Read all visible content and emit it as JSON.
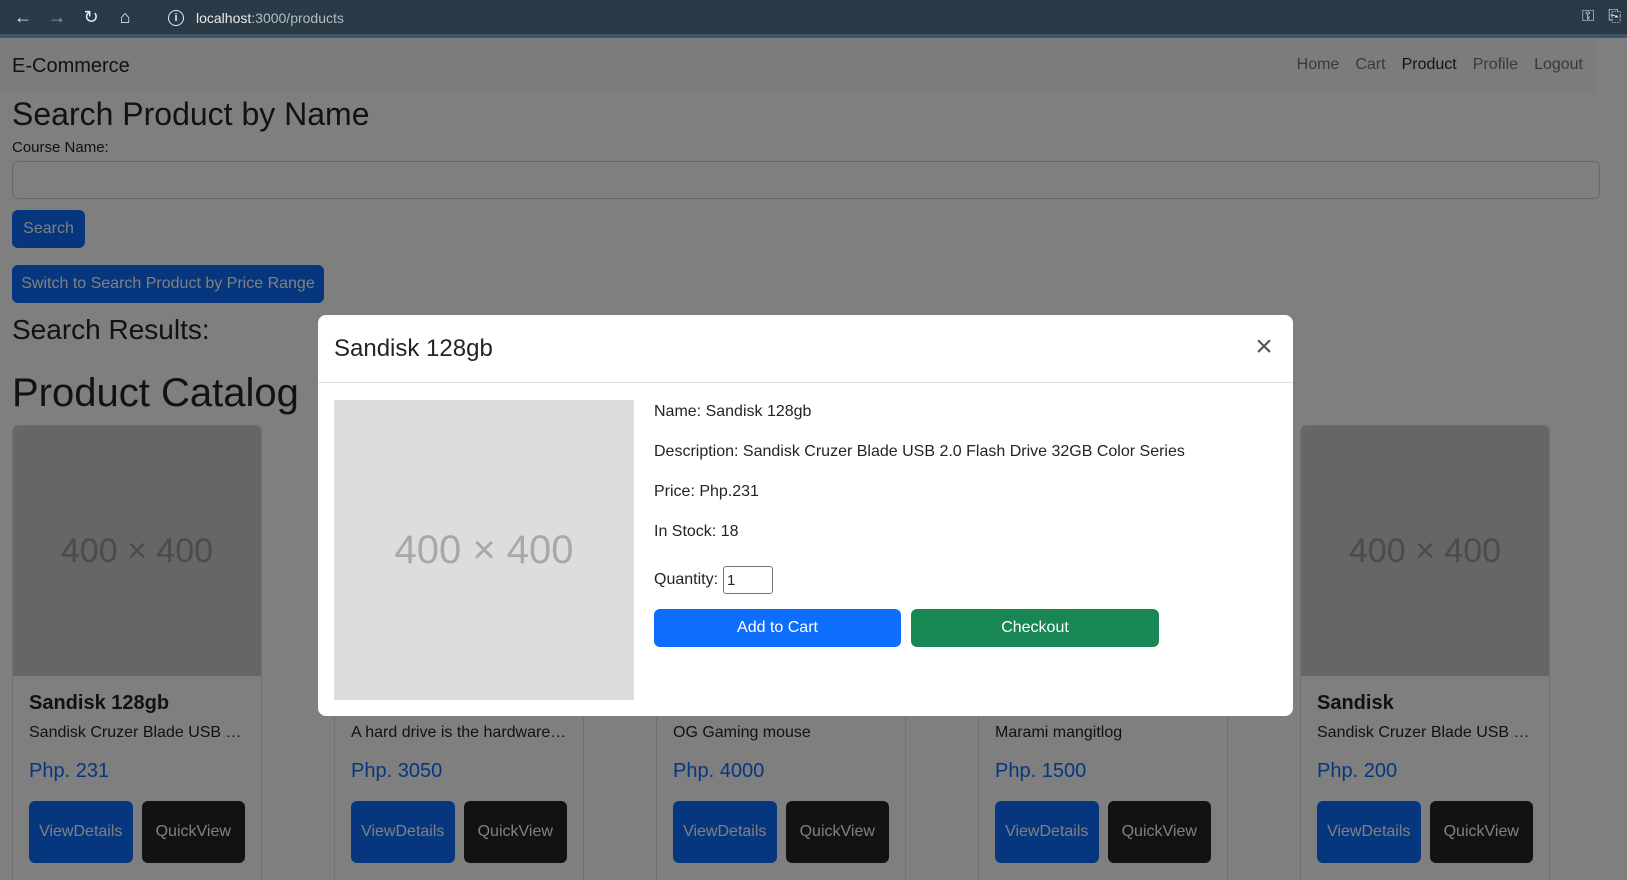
{
  "browser": {
    "url_host": "localhost",
    "url_rest": ":3000/products"
  },
  "navbar": {
    "brand": "E-Commerce",
    "links": [
      "Home",
      "Cart",
      "Product",
      "Profile",
      "Logout"
    ],
    "active": "Product"
  },
  "search": {
    "heading": "Search Product by Name",
    "label": "Course Name:",
    "value": "",
    "button": "Search",
    "switch_button": "Switch to Search Product by Price Range",
    "results_heading": "Search Results:"
  },
  "catalog": {
    "heading": "Product Catalog",
    "image_placeholder": "400 × 400",
    "view_label_1": "View",
    "view_label_2": "Details",
    "quick_label_1": "Quick",
    "quick_label_2": "View",
    "products": [
      {
        "name": "Sandisk 128gb",
        "desc": "Sandisk Cruzer Blade USB 2....",
        "price": "Php. 231"
      },
      {
        "name": "",
        "desc": "A hard drive is the hardware ...",
        "price": "Php. 3050"
      },
      {
        "name": "",
        "desc": "OG Gaming mouse",
        "price": "Php. 4000"
      },
      {
        "name": "",
        "desc": "Marami mangitlog",
        "price": "Php. 1500"
      },
      {
        "name": "Sandisk",
        "desc": "Sandisk Cruzer Blade USB 2....",
        "price": "Php. 200"
      }
    ]
  },
  "modal": {
    "title": "Sandisk 128gb",
    "image_placeholder": "400 × 400",
    "name_line": "Name: Sandisk 128gb",
    "description_line": "Description: Sandisk Cruzer Blade USB 2.0 Flash Drive 32GB Color Series",
    "price_line": "Price: Php.231",
    "stock_line": "In Stock: 18",
    "quantity_label": "Quantity:",
    "quantity_value": "1",
    "add_to_cart": "Add to Cart",
    "checkout": "Checkout"
  }
}
